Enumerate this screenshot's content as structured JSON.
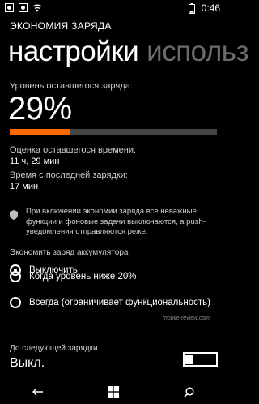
{
  "status": {
    "time": "0:46"
  },
  "app": {
    "title": "ЭКОНОМИЯ ЗАРЯДА"
  },
  "pivot": {
    "active": "настройки",
    "next": "использ"
  },
  "charge": {
    "label": "Уровень оставшегося заряда:",
    "percent_text": "29%",
    "level_percent": 29,
    "bar_color": "#ff6a00"
  },
  "estimate": {
    "label": "Оценка оставшегося времени:",
    "value": "11 ч, 29 мин"
  },
  "since_charge": {
    "label": "Время с последней зарядки:",
    "value": "17 мин"
  },
  "info": {
    "text": "При включении экономии заряда все неважные функции и фоновые задачи выключаются, а push-уведомления отправляются реже."
  },
  "saver": {
    "label": "Экономить заряд аккумулятора",
    "options": [
      {
        "label": "Выключить",
        "checked": true
      },
      {
        "label": "Когда уровень ниже 20%",
        "checked": false
      },
      {
        "label": "Всегда (ограничивает функциональность)",
        "checked": false
      }
    ]
  },
  "watermark": {
    "text": "mobile-review.com"
  },
  "next_charge": {
    "label": "До следующей зарядки",
    "value": "Выкл."
  },
  "icons": [
    "status-icons",
    "wifi-icon",
    "battery-icon",
    "shield-icon",
    "back-icon",
    "windows-icon",
    "search-icon"
  ]
}
